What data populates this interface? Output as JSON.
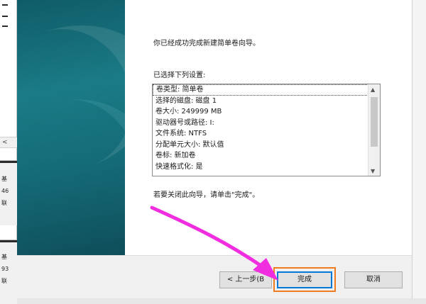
{
  "background_window": {
    "lines_top": [
      "━",
      "━",
      "━"
    ],
    "scroll_left": "<",
    "disk0_lines": [
      "基",
      "46",
      "联"
    ],
    "disk1_lines": [
      "基",
      "93",
      "联"
    ]
  },
  "wizard": {
    "intro_text": "你已经成功完成新建简单卷向导。",
    "selected_label": "已选择下列设置:",
    "settings": [
      "卷类型: 简单卷",
      "选择的磁盘: 磁盘 1",
      "卷大小: 249999 MB",
      "驱动器号或路径: I:",
      "文件系统: NTFS",
      "分配单元大小: 默认值",
      "卷标: 新加卷",
      "快速格式化: 是"
    ],
    "close_hint": "若要关闭此向导，请单击\"完成\"。",
    "buttons": {
      "back": "< 上一步(B",
      "finish": "完成",
      "cancel": "取消"
    }
  },
  "colors": {
    "annotation_arrow": "#f02ee0",
    "finish_highlight": "#f07b1e",
    "banner": "#146b77"
  }
}
